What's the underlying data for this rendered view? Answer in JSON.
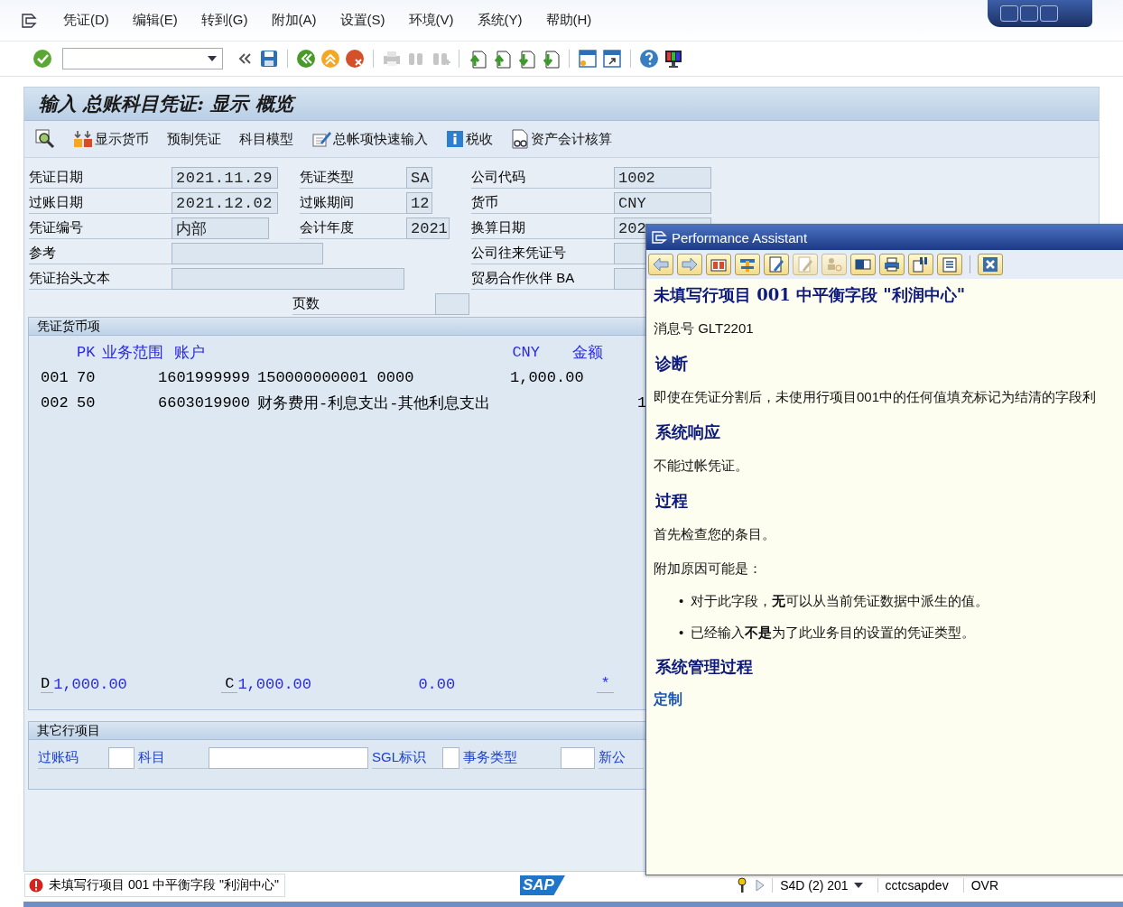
{
  "menu_bar": {
    "items": [
      "凭证(D)",
      "编辑(E)",
      "转到(G)",
      "附加(A)",
      "设置(S)",
      "环境(V)",
      "系统(Y)",
      "帮助(H)"
    ]
  },
  "toolbar": {
    "buttons": [
      {
        "kind": "enter",
        "disabled": false
      },
      {
        "kind": "collapse",
        "disabled": false
      },
      {
        "kind": "save",
        "disabled": false
      },
      {
        "kind": "sep"
      },
      {
        "kind": "back",
        "disabled": false
      },
      {
        "kind": "exit",
        "disabled": false
      },
      {
        "kind": "cancel",
        "disabled": false
      },
      {
        "kind": "sep"
      },
      {
        "kind": "print",
        "disabled": true
      },
      {
        "kind": "find",
        "disabled": true
      },
      {
        "kind": "find-next",
        "disabled": true
      },
      {
        "kind": "sep"
      },
      {
        "kind": "first",
        "disabled": false
      },
      {
        "kind": "prev",
        "disabled": false
      },
      {
        "kind": "next",
        "disabled": false
      },
      {
        "kind": "last",
        "disabled": false
      },
      {
        "kind": "sep"
      },
      {
        "kind": "session",
        "disabled": false
      },
      {
        "kind": "shortcut",
        "disabled": false
      },
      {
        "kind": "sep"
      },
      {
        "kind": "help",
        "disabled": false
      },
      {
        "kind": "layout",
        "disabled": false
      }
    ]
  },
  "screen": {
    "title": "输入 总账科目凭证: 显示 概览",
    "app_toolbar": [
      {
        "kind": "overview"
      },
      {
        "kind": "currency",
        "label": "显示货币"
      },
      {
        "kind": "text",
        "label": "预制凭证"
      },
      {
        "kind": "text",
        "label": "科目模型"
      },
      {
        "kind": "fast",
        "label": "总帐项快速输入"
      },
      {
        "kind": "info",
        "label": "税收"
      },
      {
        "kind": "asset",
        "label": "资产会计核算"
      }
    ],
    "header_rows": [
      [
        {
          "label": "凭证日期",
          "value": "2021.11.29"
        },
        {
          "label": "凭证类型",
          "value": "SA"
        },
        {
          "label": "公司代码",
          "value": "1002"
        }
      ],
      [
        {
          "label": "过账日期",
          "value": "2021.12.02"
        },
        {
          "label": "过账期间",
          "value": "12"
        },
        {
          "label": "货币",
          "value": "CNY"
        }
      ],
      [
        {
          "label": "凭证编号",
          "value": "内部"
        },
        {
          "label": "会计年度",
          "value": "2021"
        },
        {
          "label": "换算日期",
          "value": "202"
        }
      ],
      [
        {
          "label": "参考"
        },
        {
          "label": "公司往来凭证号"
        }
      ],
      [
        {
          "label": "凭证抬头文本"
        },
        {
          "label": "贸易合作伙伴 BA"
        }
      ]
    ],
    "page_count": {
      "label": "页数"
    },
    "items_group": {
      "title": "凭证货币项",
      "columns": [
        "PK",
        "业务范围",
        "账户",
        "CNY",
        "金额"
      ],
      "rows": [
        {
          "line": "001",
          "pk": "70",
          "account": "1601999999",
          "text": "150000000001 0000",
          "amount": "1,000.00"
        },
        {
          "line": "002",
          "pk": "50",
          "account": "6603019900",
          "text": "财务费用-利息支出-其他利息支出",
          "column_7": "1"
        }
      ],
      "totals": {
        "debit_label": "D",
        "debit": "1,000.00",
        "credit_label": "C",
        "credit": "1,000.00",
        "balance": "0.00",
        "marker": "*"
      }
    },
    "other_group": {
      "title": "其它行项目",
      "fields": [
        {
          "kind": "field",
          "label": "过账码"
        },
        {
          "kind": "field",
          "label": "科目"
        },
        {
          "kind": "field",
          "label": "SGL标识"
        },
        {
          "kind": "field",
          "label": "事务类型"
        },
        {
          "kind": "label",
          "label": "新公"
        }
      ]
    }
  },
  "performance_assistant": {
    "title": "Performance Assistant",
    "buttons": [
      {
        "kind": "back",
        "disabled": false
      },
      {
        "kind": "forward",
        "disabled": false
      },
      {
        "kind": "book",
        "disabled": false
      },
      {
        "kind": "tools",
        "disabled": false
      },
      {
        "kind": "edit",
        "disabled": false
      },
      {
        "kind": "link",
        "disabled": true
      },
      {
        "kind": "keyperson",
        "disabled": true
      },
      {
        "kind": "frame",
        "disabled": false
      },
      {
        "kind": "print",
        "disabled": false
      },
      {
        "kind": "find",
        "disabled": false
      },
      {
        "kind": "notes",
        "disabled": false
      },
      {
        "kind": "sep"
      },
      {
        "kind": "close",
        "disabled": false
      }
    ],
    "content": [
      {
        "kind": "title",
        "text": "未填写行项目 001 中平衡字段 \"利润中心\""
      },
      {
        "kind": "para",
        "text": "消息号 GLT2201"
      },
      {
        "kind": "heading",
        "text": "诊断"
      },
      {
        "kind": "para",
        "text": "即使在凭证分割后，未使用行项目001中的任何值填充标记为结清的字段利"
      },
      {
        "kind": "heading",
        "text": "系统响应"
      },
      {
        "kind": "para",
        "text": "不能过帐凭证。"
      },
      {
        "kind": "heading",
        "text": "过程"
      },
      {
        "kind": "para",
        "text": "首先检查您的条目。"
      },
      {
        "kind": "para",
        "text": "附加原因可能是："
      },
      {
        "kind": "bullet",
        "marker": "•",
        "text": "对于此字段，**无**可以从当前凭证数据中派生的值。"
      },
      {
        "kind": "bullet",
        "marker": "•",
        "text": "已经输入**不是**为了此业务目的设置的凭证类型。"
      },
      {
        "kind": "heading",
        "text": "系统管理过程"
      },
      {
        "kind": "link",
        "text": "定制"
      }
    ]
  },
  "status_bar": {
    "message": {
      "kind": "error",
      "text": "未填写行项目 001 中平衡字段 \"利润中心\""
    },
    "logo": "SAP",
    "system": "S4D (2) 201",
    "server": "cctcsapdev",
    "mode": "OVR"
  }
}
